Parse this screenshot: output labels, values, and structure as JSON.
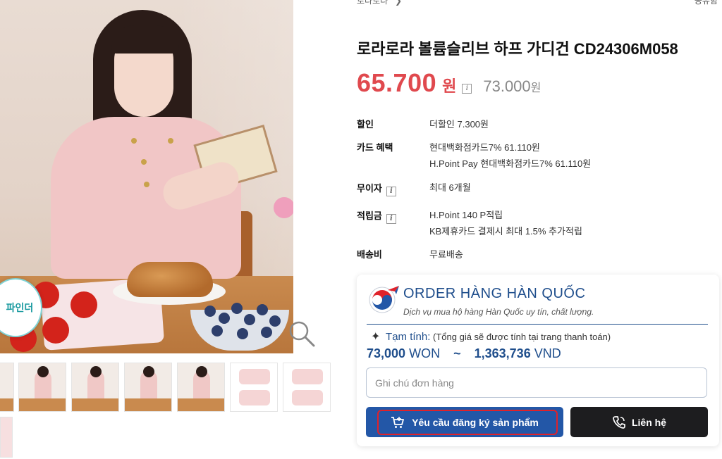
{
  "breadcrumb": {
    "label": "로라로라"
  },
  "top_right": {
    "label": "공유함"
  },
  "product": {
    "title": "로라로라 볼륨슬리브 하프 가디건 CD24306M058",
    "sale_price": "65.700",
    "sale_unit": "원",
    "original_price": "73.000",
    "original_unit": "원"
  },
  "specs": {
    "discount_label": "할인",
    "discount_value": "더할인 7.300원",
    "card_label": "카드 혜택",
    "card_value_1": "현대백화점카드7% 61.110원",
    "card_value_2": "H.Point Pay 현대백화점카드7% 61.110원",
    "installment_label": "무이자",
    "installment_value": "최대 6개월",
    "points_label": "적립금",
    "points_value_1": "H.Point 140 P적립",
    "points_value_2": "KB제휴카드 결제시 최대 1.5% 추가적립",
    "shipping_label": "배송비",
    "shipping_value": "무료배송"
  },
  "finder_badge": {
    "label": "파인더"
  },
  "order_card": {
    "title": "ORDER HÀNG HÀN QUỐC",
    "subtitle": "Dịch vụ mua hộ hàng Hàn Quốc uy tín, chất lượng.",
    "estimate_label": "Tạm tính:",
    "estimate_note": "(Tổng giá sẽ được tính tại trang thanh toán)",
    "amount_won": "73,000",
    "won_unit": "WON",
    "separator": "~",
    "amount_vnd": "1,363,736",
    "vnd_unit": "VND",
    "note_placeholder": "Ghi chú đơn hàng",
    "request_button": "Yêu cầu đăng ký sản phẩm",
    "contact_button": "Liên hệ"
  },
  "colors": {
    "sale_price": "#e0494e",
    "brand_blue": "#2357a7",
    "contact_dark": "#1d1d1f",
    "highlight_red": "#e0222a"
  },
  "icons": [
    "zoom-icon",
    "info-icon",
    "cart-icon",
    "phone-icon",
    "star-sparkle-icon",
    "chevron-right-icon"
  ]
}
